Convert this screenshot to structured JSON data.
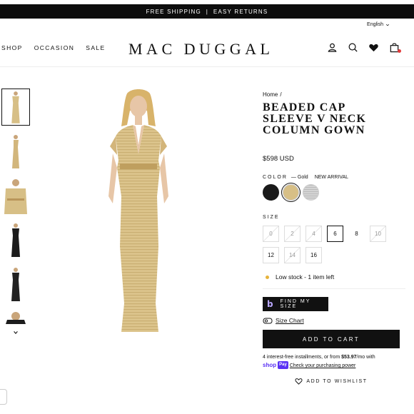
{
  "promo": {
    "text": "FREE SHIPPING  |  EASY RETURNS"
  },
  "language": {
    "selected": "English"
  },
  "nav": {
    "items": [
      "SHOP",
      "OCCASION",
      "SALE"
    ]
  },
  "brand": {
    "logo": "MAC DUGGAL"
  },
  "icons": {
    "account": "user-icon",
    "search": "search-icon",
    "wishlist": "heart-icon",
    "bag": "shopping-bag-icon"
  },
  "product": {
    "breadcrumb": {
      "home": "Home",
      "sep": "/"
    },
    "title": "BEADED CAP SLEEVE V NECK COLUMN GOWN",
    "price": "$598 USD",
    "color": {
      "label": "COLOR",
      "dash": "—",
      "selected": "Gold",
      "badge": "NEW ARRIVAL",
      "swatches": [
        {
          "name": "Black",
          "hex": "#1a1a1a"
        },
        {
          "name": "Gold",
          "hex": "#d7bf86"
        },
        {
          "name": "Silver",
          "hex": "#c7c7c7"
        }
      ]
    },
    "size": {
      "label": "SIZE",
      "options": [
        {
          "label": "0",
          "state": "unavailable"
        },
        {
          "label": "2",
          "state": "unavailable"
        },
        {
          "label": "4",
          "state": "unavailable"
        },
        {
          "label": "6",
          "state": "selected"
        },
        {
          "label": "8",
          "state": "available"
        },
        {
          "label": "10",
          "state": "unavailable"
        },
        {
          "label": "12",
          "state": "available"
        },
        {
          "label": "14",
          "state": "unavailable"
        },
        {
          "label": "16",
          "state": "available"
        }
      ]
    },
    "stock": "Low stock - 1 item left",
    "fit_button": "FIND MY SIZE",
    "size_chart": "Size Chart",
    "add_to_cart": "ADD TO CART",
    "installments": {
      "prefix": "4 interest-free installments, or from",
      "amount": "$53.97",
      "suffix": "/mo with",
      "shop": "shop",
      "pay": "Pay",
      "link": "Check your purchasing power"
    },
    "wishlist": "ADD TO WISHLIST"
  },
  "colors": {
    "accent": "#111111",
    "gold": "#d7bf86",
    "stock_dot": "#e7b33b",
    "shoppay": "#5a31f4"
  }
}
